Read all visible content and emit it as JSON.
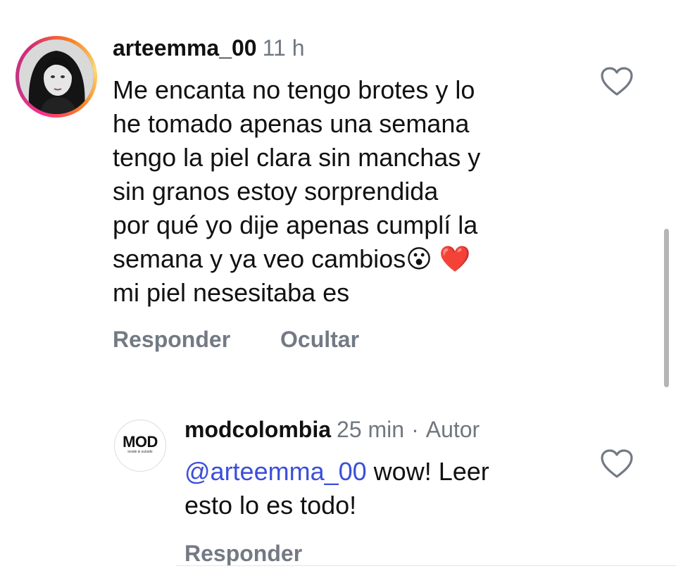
{
  "comment": {
    "username": "arteemma_00",
    "time": "11 h",
    "text_lines": [
      "Me encanta no tengo brotes y lo",
      "he tomado apenas una semana",
      "tengo la piel clara sin manchas y",
      "sin granos estoy sorprendida",
      "por qué yo dije apenas cumplí la",
      "semana y ya veo cambios",
      "mi piel nesesitaba es"
    ],
    "emoji_surprised": "😮",
    "emoji_heart": "❤️",
    "actions": {
      "reply": "Responder",
      "hide": "Ocultar"
    },
    "like_icon": "heart-outline-icon"
  },
  "reply": {
    "username": "modcolombia",
    "time": "25 min",
    "separator": "·",
    "author_badge": "Autor",
    "mention": "@arteemma_00",
    "text_line1_rest": " wow! Leer",
    "text_line2": "esto lo es todo!",
    "logo_text": "MOD",
    "logo_tagline": "inside & outside",
    "actions": {
      "reply": "Responder"
    },
    "like_icon": "heart-outline-icon"
  },
  "colors": {
    "mention": "#3b4fd8",
    "meta": "#707780",
    "action": "#737a84"
  }
}
